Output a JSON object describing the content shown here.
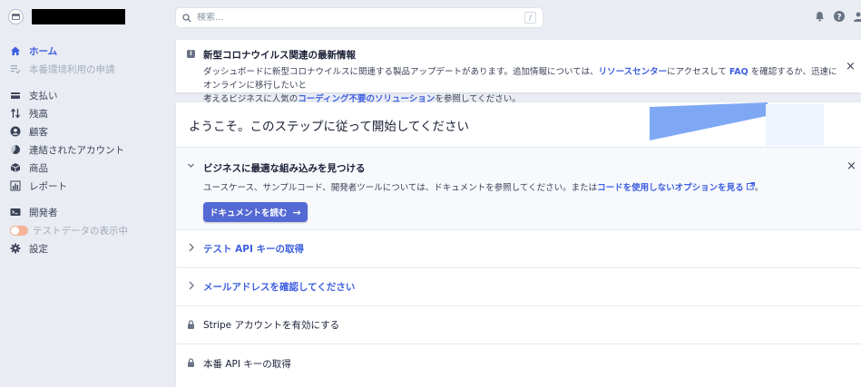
{
  "header": {
    "search_placeholder": "検索...",
    "search_shortcut": "/"
  },
  "sidebar": {
    "items": [
      {
        "label": "ホーム"
      },
      {
        "label": "本番環境利用の申請"
      },
      {
        "label": "支払い"
      },
      {
        "label": "残高"
      },
      {
        "label": "顧客"
      },
      {
        "label": "連結されたアカウント"
      },
      {
        "label": "商品"
      },
      {
        "label": "レポート"
      },
      {
        "label": "開発者"
      },
      {
        "label": "テストデータの表示中"
      },
      {
        "label": "設定"
      }
    ]
  },
  "notice": {
    "title": "新型コロナウイルス関連の最新情報",
    "body_1": "ダッシュボードに新型コロナウイルスに関連する製品アップデートがあります。追加情報については、",
    "link_resource": "リソースセンター",
    "body_2": "にアクセスして ",
    "link_faq": "FAQ",
    "body_3": " を確認するか、迅速にオンラインに移行したいと",
    "body_4": "考えるビジネスに人気の",
    "link_nocode": "コーディング不要のソリューション",
    "body_5": "を参照してください。",
    "close": "×"
  },
  "onboarding": {
    "title": "ようこそ。このステップに従って開始してください",
    "open_step": {
      "title": "ビジネスに最適な組み込みを見つける",
      "desc": "ユースケース、サンプルコード、開発者ツールについては、ドキュメントを参照してください。または",
      "desc_link": "コードを使用しないオプションを見る",
      "desc_end": "。",
      "button": "ドキュメントを読む",
      "button_arrow": "→",
      "close": "×"
    },
    "steps": [
      {
        "label": "テスト API キーの取得"
      },
      {
        "label": "メールアドレスを確認してください"
      },
      {
        "label": "Stripe アカウントを有効にする"
      },
      {
        "label": "本番 API キーの取得"
      }
    ]
  },
  "colors": {
    "accent": "#3d5ee0",
    "button": "#5469d4",
    "background": "#e9ecf2"
  }
}
